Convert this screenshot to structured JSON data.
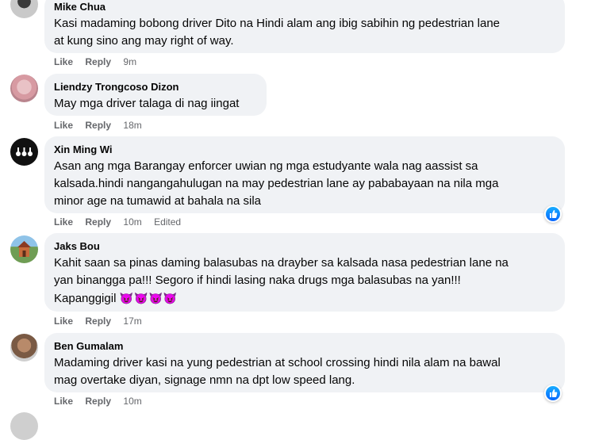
{
  "comments": [
    {
      "author": "Mike Chua",
      "text_lines": [
        "Kasi madaming bobong driver Dito na Hindi alam ang ibig sabihin ng pedestrian lane",
        "at kung sino ang may right of way."
      ],
      "like": "Like",
      "reply": "Reply",
      "time": "9m",
      "edited": ""
    },
    {
      "author": "Liendzy Trongcoso Dizon",
      "text_lines": [
        "May mga driver talaga di nag iingat"
      ],
      "like": "Like",
      "reply": "Reply",
      "time": "18m",
      "edited": ""
    },
    {
      "author": "Xin Ming Wi",
      "text_lines": [
        "Asan ang mga Barangay enforcer uwian ng mga estudyante wala nag aassist sa",
        "kalsada.hindi nangangahulugan na may pedestrian lane ay pababayaan na nila mga",
        "minor age na tumawid at bahala na sila"
      ],
      "like": "Like",
      "reply": "Reply",
      "time": "10m",
      "edited": "Edited",
      "reaction_icon": "like-reaction-icon"
    },
    {
      "author": "Jaks Bou",
      "text_lines": [
        "Kahit saan sa pinas daming balasubas na drayber sa kalsada nasa pedestrian lane na",
        "yan binangga pa!!! Segoro if hindi lasing naka drugs mga balasubas na yan!!!",
        "Kapanggigil"
      ],
      "emoji": "😈😈😈😈",
      "like": "Like",
      "reply": "Reply",
      "time": "17m",
      "edited": ""
    },
    {
      "author": "Ben Gumalam",
      "text_lines": [
        "Madaming driver kasi na yung pedestrian at school crossing hindi nila alam na bawal",
        "mag overtake diyan, signage nmn na dpt low speed lang."
      ],
      "like": "Like",
      "reply": "Reply",
      "time": "10m",
      "edited": "",
      "reaction_icon": "like-reaction-icon"
    }
  ],
  "colors": {
    "bubble": "#f0f2f5",
    "meta": "#65676b",
    "like_blue": "#0866ff"
  }
}
